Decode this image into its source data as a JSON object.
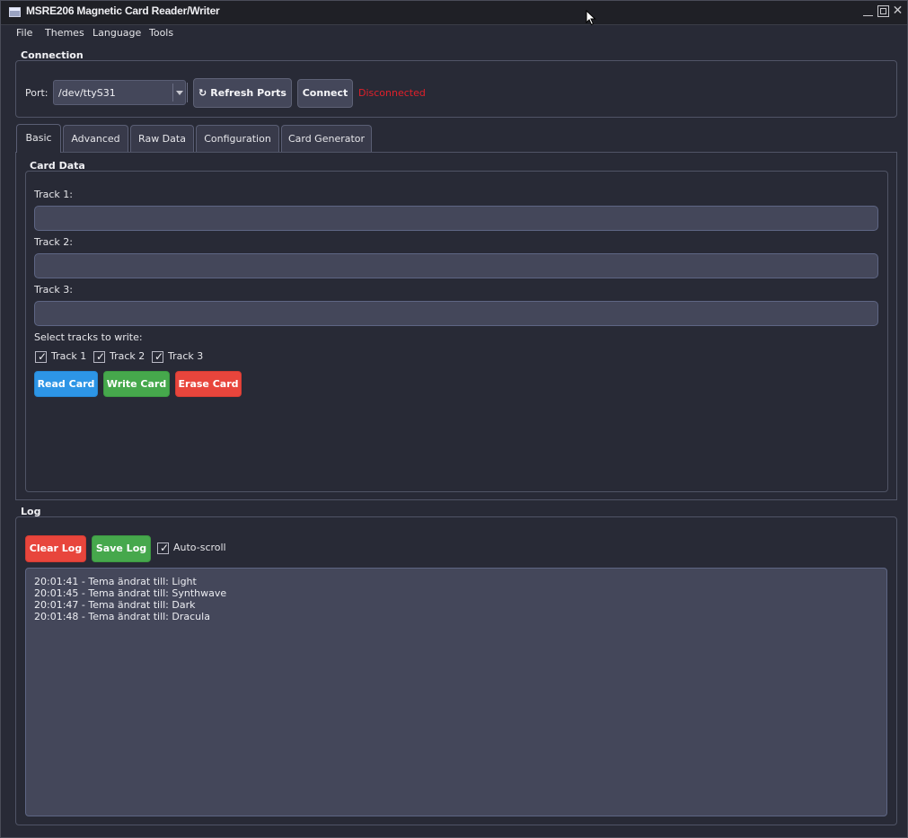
{
  "window": {
    "title": "MSRE206 Magnetic Card Reader/Writer"
  },
  "menu": [
    "File",
    "Themes",
    "Language",
    "Tools"
  ],
  "connection": {
    "group_title": "Connection",
    "port_label": "Port:",
    "port_value": "/dev/ttyS31",
    "refresh_label": "Refresh Ports",
    "connect_label": "Connect",
    "status": "Disconnected"
  },
  "tabs": [
    "Basic",
    "Advanced",
    "Raw Data",
    "Configuration",
    "Card Generator"
  ],
  "card_data": {
    "group_title": "Card Data",
    "track1_label": "Track 1:",
    "track1_value": "",
    "track2_label": "Track 2:",
    "track2_value": "",
    "track3_label": "Track 3:",
    "track3_value": "",
    "select_label": "Select tracks to write:",
    "tracks": [
      {
        "label": "Track 1",
        "checked": true
      },
      {
        "label": "Track 2",
        "checked": true
      },
      {
        "label": "Track 3",
        "checked": true
      }
    ],
    "read_label": "Read Card",
    "write_label": "Write Card",
    "erase_label": "Erase Card"
  },
  "log": {
    "group_title": "Log",
    "clear_label": "Clear Log",
    "save_label": "Save Log",
    "autoscroll_label": "Auto-scroll",
    "autoscroll_checked": true,
    "lines": [
      "20:01:41 - Tema ändrat till: Light",
      "20:01:45 - Tema ändrat till: Synthwave",
      "20:01:47 - Tema ändrat till: Dark",
      "20:01:48 - Tema ändrat till: Dracula"
    ]
  },
  "colors": {
    "background": "#282a36",
    "input": "#44475a",
    "status_disconnected": "#e0202a",
    "read_button": "#2d95e6",
    "write_button": "#46a84c",
    "erase_button": "#e8453c"
  }
}
